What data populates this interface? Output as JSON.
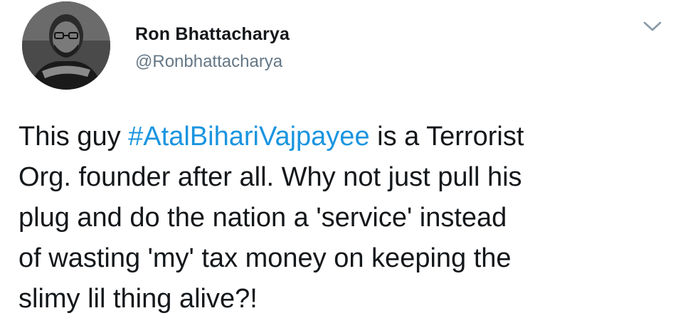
{
  "author": {
    "display_name": "Ron Bhattacharya",
    "handle": "@Ronbhattacharya"
  },
  "icons": {
    "avatar": "user-photo",
    "menu": "chevron-down-icon"
  },
  "colors": {
    "hashtag": "#1b95e0",
    "handle": "#657786",
    "text": "#14171a"
  },
  "tweet": {
    "line1_before": "This guy ",
    "hashtag": "#AtalBihariVajpayee",
    "line1_after": " is a Terrorist",
    "line2": "Org. founder after all. Why not just pull his",
    "line3": "plug and do the nation a 'service' instead",
    "line4": "of wasting 'my' tax money on keeping the",
    "line5": "slimy lil thing alive?!"
  }
}
